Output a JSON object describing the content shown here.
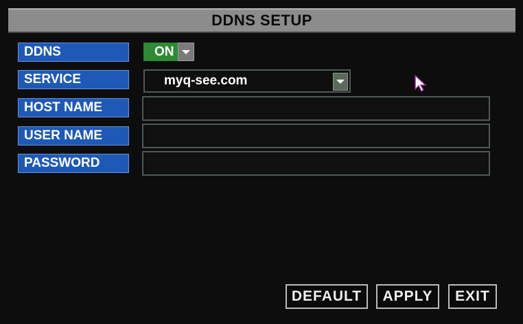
{
  "title": "DDNS SETUP",
  "fields": {
    "ddns": {
      "label": "DDNS",
      "value": "ON"
    },
    "service": {
      "label": "SERVICE",
      "value": "myq-see.com"
    },
    "host_name": {
      "label": "HOST NAME",
      "value": ""
    },
    "user_name": {
      "label": "USER NAME",
      "value": ""
    },
    "password": {
      "label": "PASSWORD",
      "value": ""
    }
  },
  "buttons": {
    "default": "DEFAULT",
    "apply": "APPLY",
    "exit": "EXIT"
  },
  "colors": {
    "label_bg": "#1e59b8",
    "toggle_on": "#2e8a34",
    "title_bg": "#8c8c8c",
    "background": "#0d0d0d"
  },
  "icons": {
    "dropdown": "chevron-down-icon",
    "pointer": "mouse-cursor-icon"
  }
}
